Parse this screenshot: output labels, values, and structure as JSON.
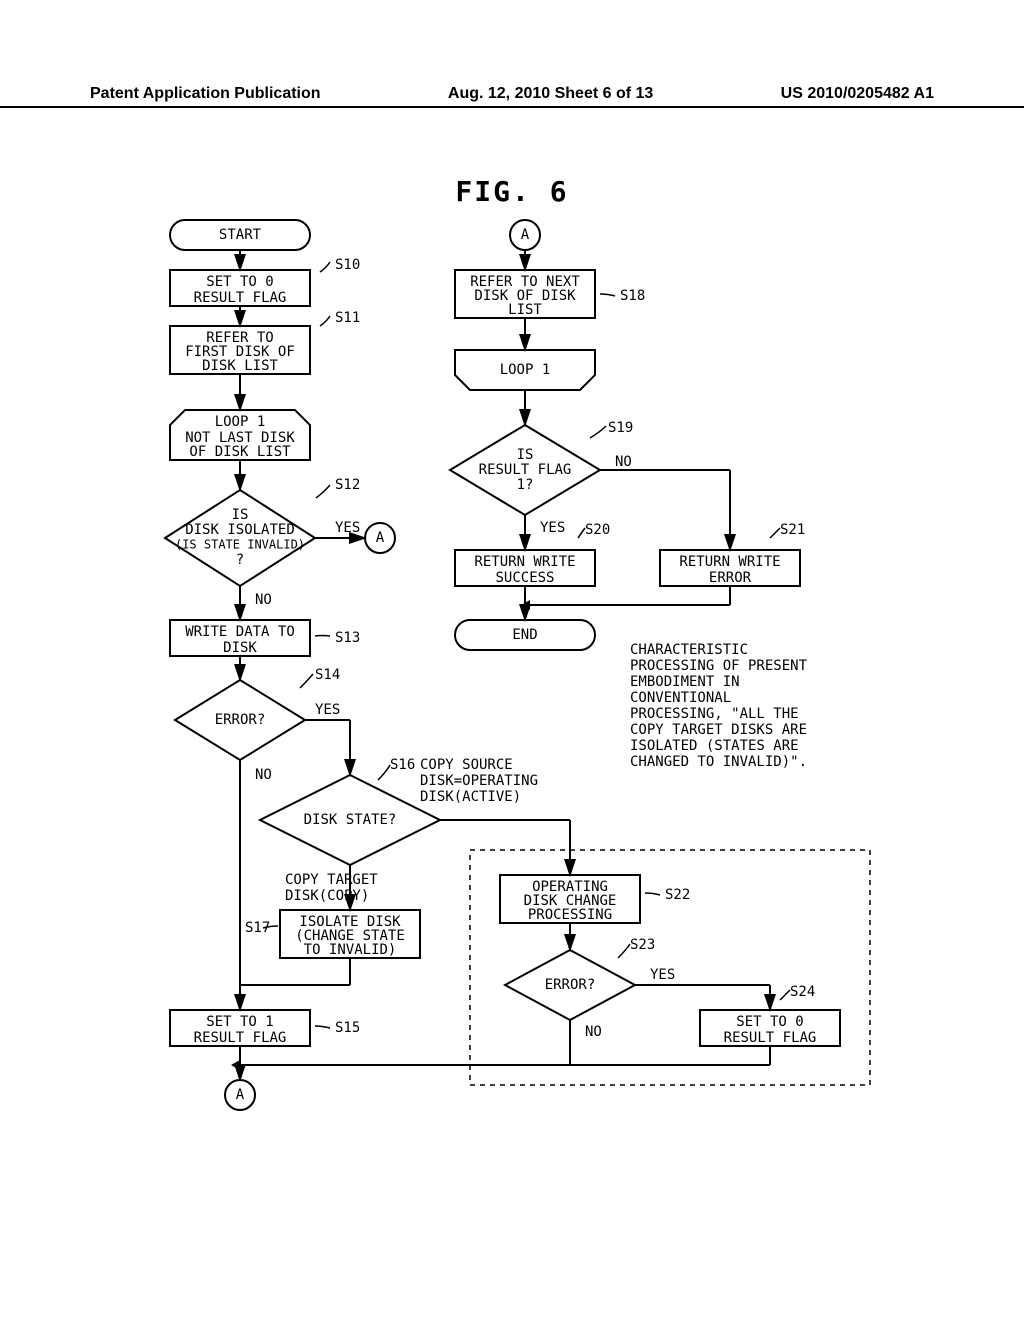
{
  "header": {
    "left": "Patent Application Publication",
    "center": "Aug. 12, 2010  Sheet 6 of 13",
    "right": "US 2010/0205482 A1"
  },
  "figure_title": "FIG. 6",
  "nodes": {
    "start": "START",
    "s10": {
      "label": "S10",
      "text1": "SET TO 0",
      "text2": "RESULT FLAG"
    },
    "s11": {
      "label": "S11",
      "text1": "REFER TO",
      "text2": "FIRST DISK OF",
      "text3": "DISK LIST"
    },
    "loop1a": {
      "text1": "LOOP 1",
      "text2": "NOT LAST DISK",
      "text3": "OF DISK LIST"
    },
    "s12": {
      "label": "S12",
      "text1": "IS",
      "text2": "DISK ISOLATED",
      "text3": "(IS STATE INVALID)",
      "text4": "?",
      "yes": "YES",
      "no": "NO"
    },
    "s13": {
      "label": "S13",
      "text1": "WRITE DATA TO",
      "text2": "DISK"
    },
    "s14": {
      "label": "S14",
      "text1": "ERROR?",
      "yes": "YES",
      "no": "NO"
    },
    "s15": {
      "label": "S15",
      "text1": "SET TO 1",
      "text2": "RESULT FLAG"
    },
    "s16": {
      "label": "S16",
      "text1": "DISK STATE?",
      "left": "COPY TARGET",
      "left2": "DISK(COPY)",
      "right": "COPY SOURCE",
      "right2": "DISK=OPERATING",
      "right3": "DISK(ACTIVE)"
    },
    "s17": {
      "label": "S17",
      "text1": "ISOLATE DISK",
      "text2": "(CHANGE STATE",
      "text3": "TO INVALID)"
    },
    "s18": {
      "label": "S18",
      "text1": "REFER TO NEXT",
      "text2": "DISK OF DISK",
      "text3": "LIST"
    },
    "loop1b": "LOOP 1",
    "s19": {
      "label": "S19",
      "text1": "IS",
      "text2": "RESULT FLAG",
      "text3": "1?",
      "yes": "YES",
      "no": "NO"
    },
    "s20": {
      "label": "S20",
      "text1": "RETURN WRITE",
      "text2": "SUCCESS"
    },
    "s21": {
      "label": "S21",
      "text1": "RETURN WRITE",
      "text2": "ERROR"
    },
    "s22": {
      "label": "S22",
      "text1": "OPERATING",
      "text2": "DISK CHANGE",
      "text3": "PROCESSING"
    },
    "s23": {
      "label": "S23",
      "text1": "ERROR?",
      "yes": "YES",
      "no": "NO"
    },
    "s24": {
      "label": "S24",
      "text1": "SET TO 0",
      "text2": "RESULT FLAG"
    },
    "end": "END",
    "connectorA": "A"
  },
  "annotation": {
    "line1": "CHARACTERISTIC",
    "line2": "PROCESSING OF PRESENT",
    "line3": "EMBODIMENT IN",
    "line4": "CONVENTIONAL",
    "line5": "PROCESSING, \"ALL THE",
    "line6": "COPY TARGET DISKS ARE",
    "line7": "ISOLATED (STATES ARE",
    "line8": "CHANGED TO INVALID)\"."
  }
}
